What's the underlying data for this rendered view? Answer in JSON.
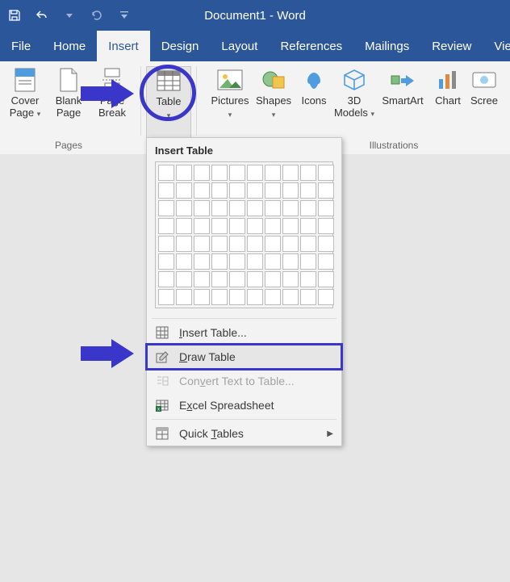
{
  "title": "Document1  -  Word",
  "qat": {
    "save": "Save",
    "undo": "Undo",
    "redo": "Redo",
    "customize": "Customize"
  },
  "tabs": {
    "file": "File",
    "home": "Home",
    "insert": "Insert",
    "design": "Design",
    "layout": "Layout",
    "references": "References",
    "mailings": "Mailings",
    "review": "Review",
    "view": "Vie"
  },
  "ribbon": {
    "groups": {
      "pages": "Pages",
      "illustrations": "Illustrations"
    },
    "cover_page": "Cover Page",
    "blank_page": "Blank Page",
    "page_break": "Page Break",
    "table": "Table",
    "pictures": "Pictures",
    "shapes": "Shapes",
    "icons": "Icons",
    "models": "3D Models",
    "smartart": "SmartArt",
    "chart": "Chart",
    "screenshot": "Scree"
  },
  "menu": {
    "heading": "Insert Table",
    "insert_table": "Insert Table...",
    "draw_table": "Draw Table",
    "convert": "Convert Text to Table...",
    "excel": "Excel Spreadsheet",
    "quick_tables": "Quick Tables"
  },
  "grid": {
    "cols": 10,
    "rows": 8
  },
  "colors": {
    "accent": "#2b579a",
    "annotation": "#3a36c9"
  }
}
